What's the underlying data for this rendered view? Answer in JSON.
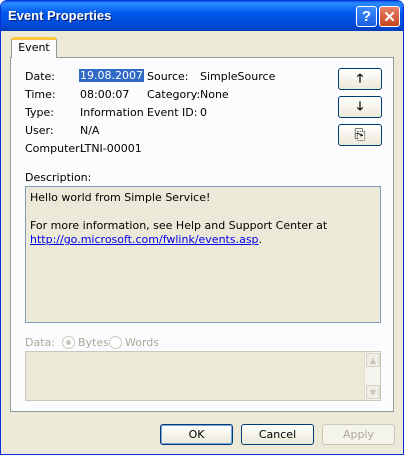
{
  "window": {
    "title": "Event Properties",
    "help_glyph": "?",
    "close_glyph": "✕"
  },
  "tabs": [
    {
      "label": "Event",
      "active": true
    }
  ],
  "event": {
    "date_label": "Date:",
    "date_value": "19.08.2007",
    "time_label": "Time:",
    "time_value": "08:00:07",
    "type_label": "Type:",
    "type_value": "Information",
    "user_label": "User:",
    "user_value": "N/A",
    "computer_label": "Computer:",
    "computer_value": "LTNI-00001",
    "source_label": "Source:",
    "source_value": "SimpleSource",
    "category_label": "Category:",
    "category_value": "None",
    "eventid_label": "Event ID:",
    "eventid_value": "0"
  },
  "nav": {
    "up_glyph": "🡑",
    "down_glyph": "🡓",
    "copy_glyph": "⎘"
  },
  "description": {
    "label": "Description:",
    "line1": "Hello world from Simple Service!",
    "line2": "For more information, see Help and Support Center at",
    "link": "http://go.microsoft.com/fwlink/events.asp",
    "link_suffix": "."
  },
  "data_section": {
    "label": "Data:",
    "options": [
      "Bytes",
      "Words"
    ],
    "selected": "Bytes"
  },
  "buttons": {
    "ok": "OK",
    "cancel": "Cancel",
    "apply": "Apply"
  }
}
